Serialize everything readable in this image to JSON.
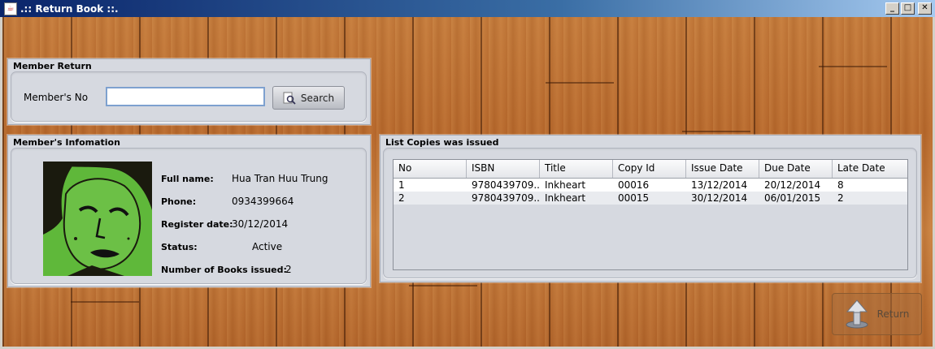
{
  "window": {
    "title": ".:: Return Book ::.",
    "buttons": {
      "minimize": "_",
      "maximize": "□",
      "close": "✕"
    }
  },
  "member_return": {
    "title": "Member Return",
    "member_no_label": "Member's No",
    "member_no_value": "",
    "search_label": "Search"
  },
  "member_info": {
    "title": "Member's Infomation",
    "full_name_label": "Full name:",
    "full_name": "Hua Tran Huu Trung",
    "phone_label": "Phone:",
    "phone": "0934399664",
    "register_label": "Register date:",
    "register_date": "30/12/2014",
    "status_label": "Status:",
    "status": "Active",
    "books_label": "Number of Books issued:",
    "books_issued": "2"
  },
  "copies": {
    "title": "List Copies was issued",
    "columns": [
      "No",
      "ISBN",
      "Title",
      "Copy Id",
      "Issue Date",
      "Due Date",
      "Late Date"
    ],
    "rows": [
      [
        "1",
        "9780439709...",
        "Inkheart",
        "00016",
        "13/12/2014",
        "20/12/2014",
        "8"
      ],
      [
        "2",
        "9780439709...",
        "Inkheart",
        "00015",
        "30/12/2014",
        "06/01/2015",
        "2"
      ]
    ]
  },
  "return_button": {
    "label": "Return"
  },
  "colors": {
    "panel": "#d6d9e0",
    "wood": "#c47a3a",
    "photo_tint": "#5fb83a"
  }
}
